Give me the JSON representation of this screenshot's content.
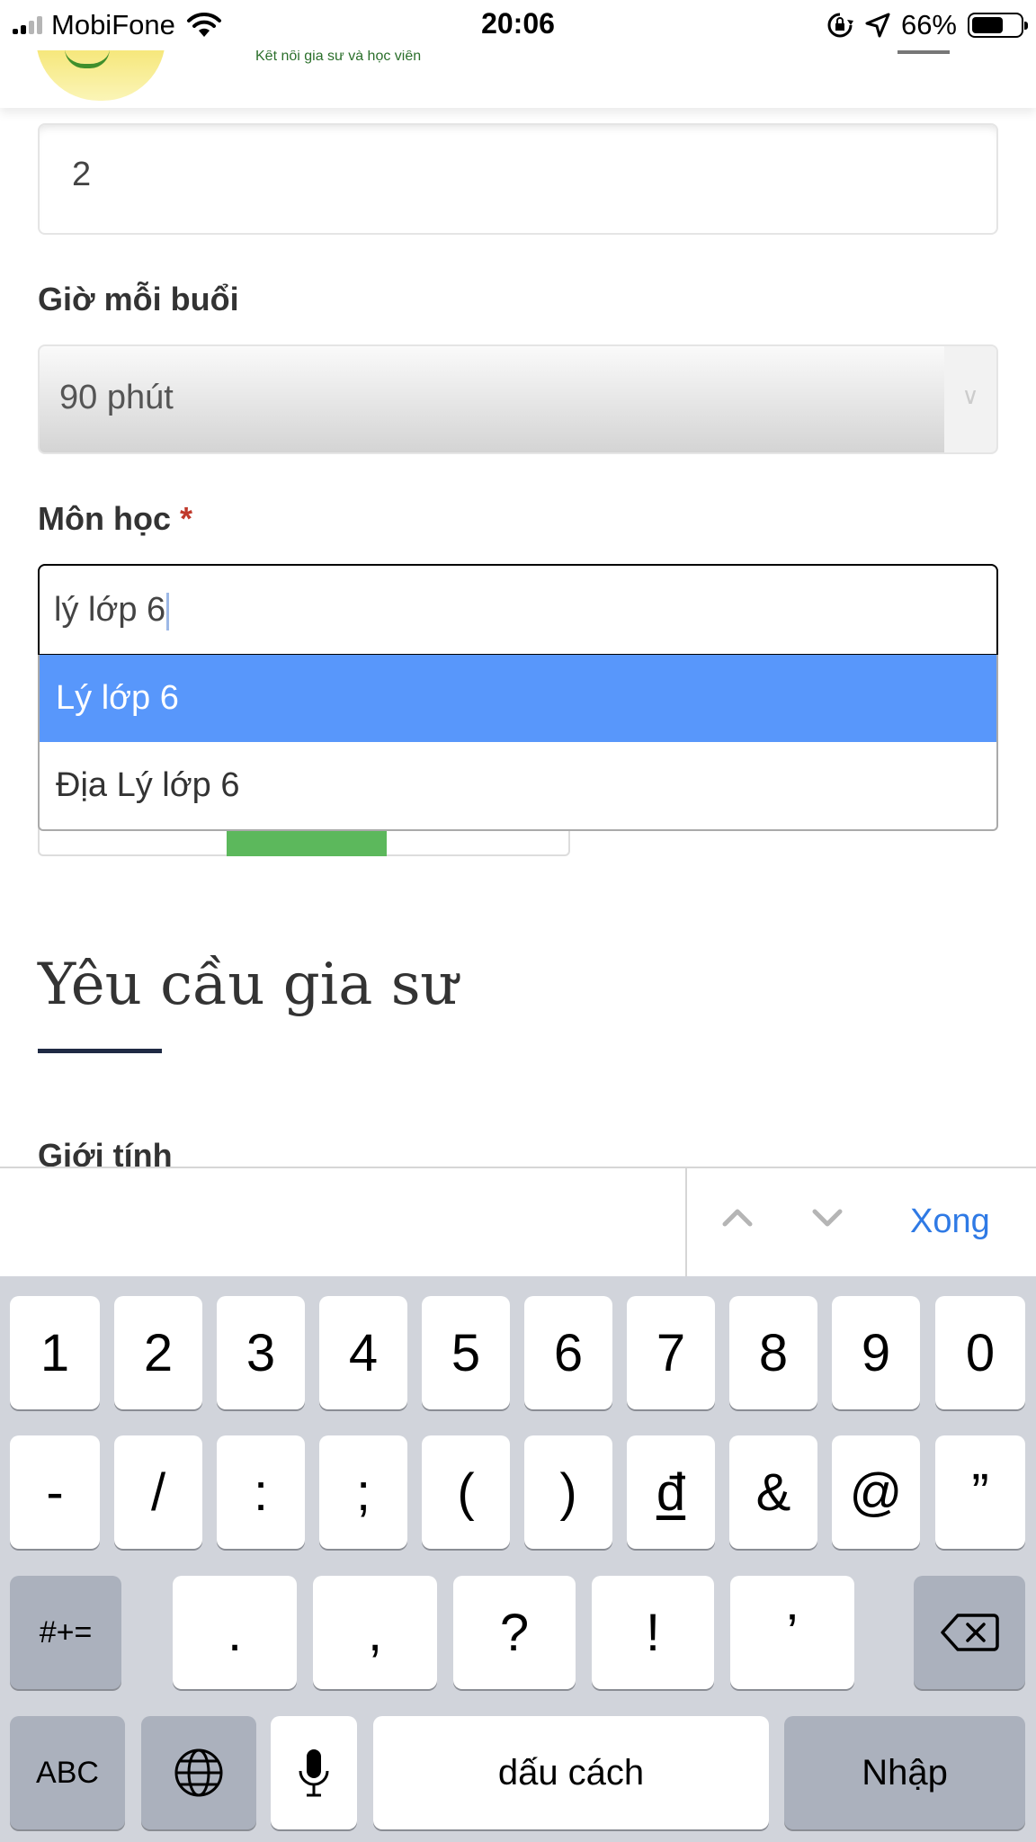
{
  "status_bar": {
    "carrier": "MobiFone",
    "time": "20:06",
    "battery": "66%",
    "battery_level": 0.66
  },
  "header": {
    "tagline": "Kết nối gia sư và học viên"
  },
  "form": {
    "sessions_value": "2",
    "duration_label": "Giờ mỗi buổi",
    "duration_value": "90 phút",
    "subject_label": "Môn học",
    "required_mark": "*",
    "subject_input": "lý lớp 6",
    "suggestions": [
      "Lý lớp 6",
      "Địa Lý lớp 6"
    ]
  },
  "section": {
    "title": "Yêu cầu gia sư",
    "gender_label": "Giới tính"
  },
  "accessory": {
    "done_label": "Xong"
  },
  "keyboard": {
    "row1": [
      "1",
      "2",
      "3",
      "4",
      "5",
      "6",
      "7",
      "8",
      "9",
      "0"
    ],
    "row2": [
      "-",
      "/",
      ":",
      ";",
      "(",
      ")",
      "đ",
      "&",
      "@",
      "”"
    ],
    "row3_switch": "#+=",
    "row3": [
      ".",
      ",",
      "?",
      "!",
      "’"
    ],
    "abc": "ABC",
    "space": "dấu cách",
    "return": "Nhập"
  }
}
